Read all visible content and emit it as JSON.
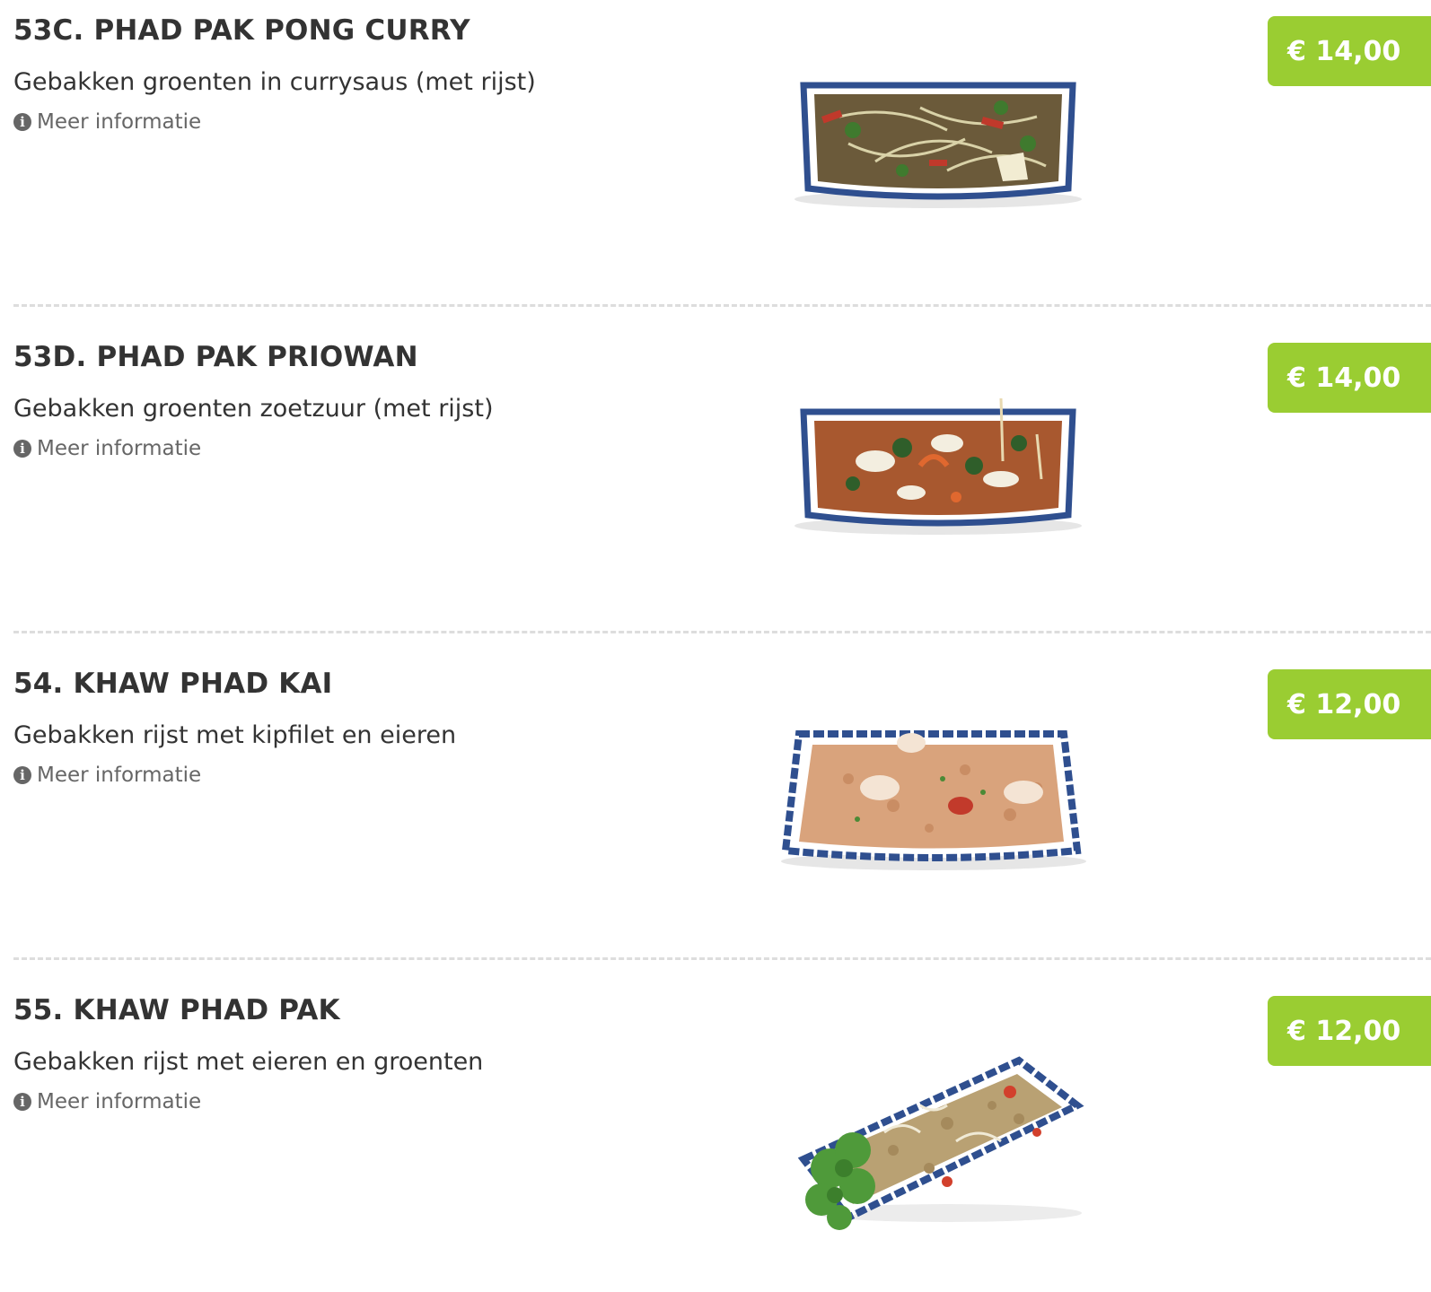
{
  "menu": {
    "items": [
      {
        "title": "53C. PHAD PAK PONG CURRY",
        "description": "Gebakken groenten in currysaus (met rijst)",
        "info_label": "Meer informatie",
        "price": "€ 14,00"
      },
      {
        "title": "53D. PHAD PAK PRIOWAN",
        "description": "Gebakken groenten zoetzuur (met rijst)",
        "info_label": "Meer informatie",
        "price": "€ 14,00"
      },
      {
        "title": "54. KHAW PHAD KAI",
        "description": "Gebakken rijst met kipfilet en eieren",
        "info_label": "Meer informatie",
        "price": "€ 12,00"
      },
      {
        "title": "55. KHAW PHAD PAK",
        "description": "Gebakken rijst met eieren en groenten",
        "info_label": "Meer informatie",
        "price": "€ 12,00"
      }
    ]
  },
  "icons": {
    "info": "info-circle-icon"
  },
  "colors": {
    "price_button": "#9acd32",
    "title_text": "#333333",
    "info_text": "#666666",
    "divider": "#dddddd"
  }
}
